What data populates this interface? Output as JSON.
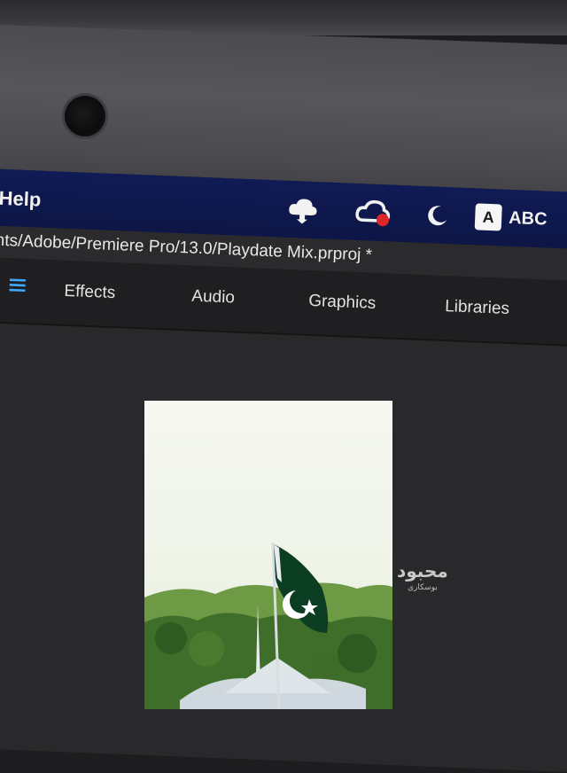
{
  "menubar": {
    "help_label": "Help",
    "tray": {
      "cloud_icon": "creative-cloud-sync-icon",
      "cc_icon": "creative-cloud-icon",
      "moon_icon": "do-not-disturb-moon-icon",
      "abc_badge": "A",
      "abc_label": "ABC"
    }
  },
  "titlebar": {
    "path": "nts/Adobe/Premiere Pro/13.0/Playdate Mix.prproj *"
  },
  "workspaces": {
    "menu_icon": "hamburger-menu-icon",
    "tabs": [
      {
        "label": "Effects"
      },
      {
        "label": "Audio"
      },
      {
        "label": "Graphics"
      },
      {
        "label": "Libraries"
      }
    ]
  },
  "watermark": {
    "main": "محبود",
    "sub": "بوسکاری"
  },
  "colors": {
    "menubar": "#101a55",
    "accent_menu_icon": "#3fa9ff",
    "cc_badge": "#e0262a",
    "flag_green": "#0b3d22"
  }
}
